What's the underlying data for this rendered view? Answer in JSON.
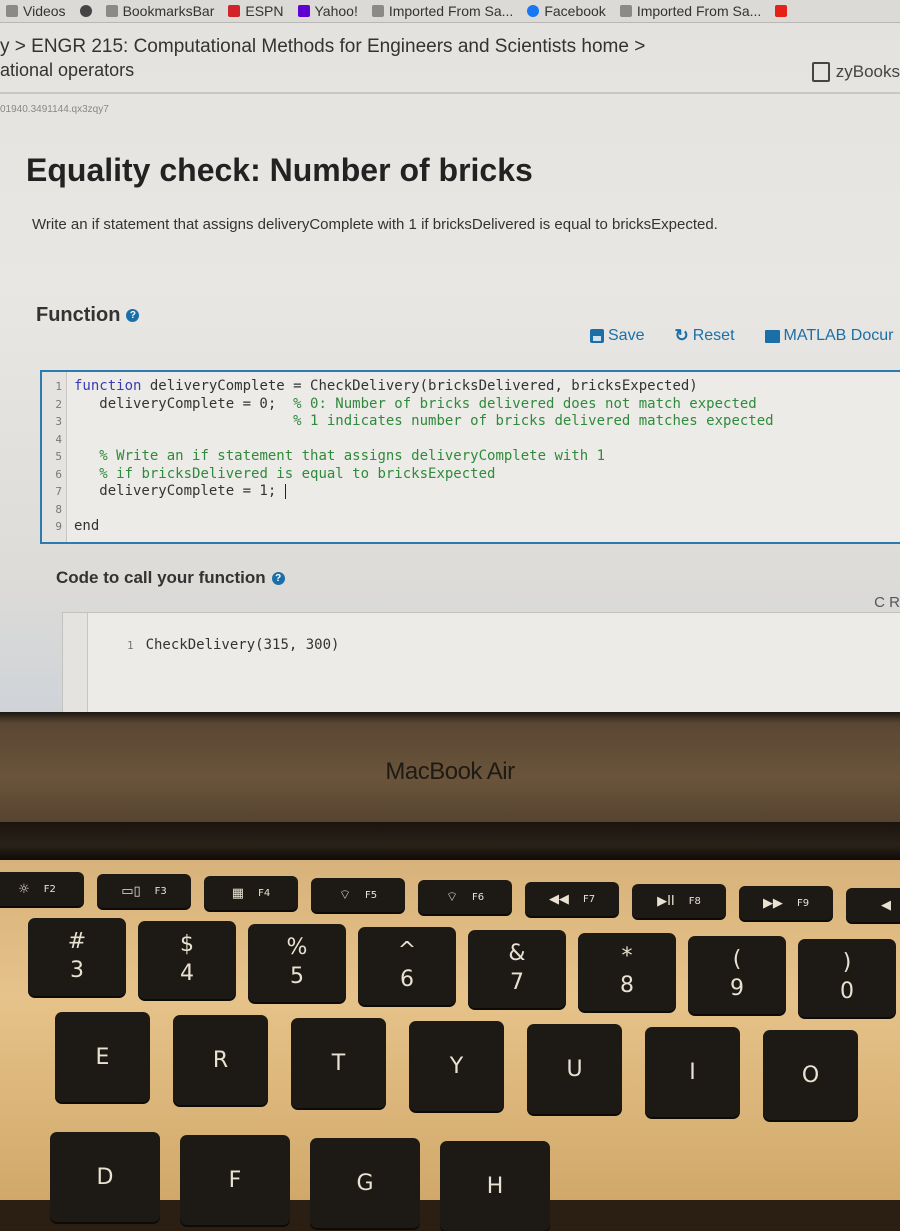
{
  "bookmarks_bar": {
    "items": [
      {
        "label": "Videos",
        "icon": "folder-icon"
      },
      {
        "label": "",
        "icon": "globe-icon"
      },
      {
        "label": "BookmarksBar",
        "icon": "folder-icon"
      },
      {
        "label": "ESPN",
        "icon": "espn-icon"
      },
      {
        "label": "Yahoo!",
        "icon": "yahoo-icon"
      },
      {
        "label": "Imported From Sa...",
        "icon": "folder-icon"
      },
      {
        "label": "Facebook",
        "icon": "facebook-icon"
      },
      {
        "label": "Imported From Sa...",
        "icon": "folder-icon"
      },
      {
        "label": "",
        "icon": "youtube-icon"
      }
    ]
  },
  "breadcrumb": {
    "line1": "y > ENGR 215: Computational Methods for Engineers and Scientists home >",
    "line2": "ational operators",
    "brand": "zyBooks"
  },
  "session_id": "01940.3491144.qx3zqy7",
  "challenge": {
    "title": "Equality check: Number of bricks",
    "instructions": "Write an if statement that assigns deliveryComplete with 1 if bricksDelivered is equal to bricksExpected."
  },
  "function_section": {
    "label": "Function",
    "toolbar": {
      "save": "Save",
      "reset": "Reset",
      "docs": "MATLAB Docur"
    },
    "lines": [
      {
        "n": "1",
        "kw": "function",
        "code": " deliveryComplete = CheckDelivery(bricksDelivered, bricksExpected)",
        "comment": ""
      },
      {
        "n": "2",
        "kw": "",
        "code": "   deliveryComplete = 0;  ",
        "comment": "% 0: Number of bricks delivered does not match expected"
      },
      {
        "n": "3",
        "kw": "",
        "code": "                          ",
        "comment": "% 1 indicates number of bricks delivered matches expected"
      },
      {
        "n": "4",
        "kw": "",
        "code": "",
        "comment": ""
      },
      {
        "n": "5",
        "kw": "",
        "code": "   ",
        "comment": "% Write an if statement that assigns deliveryComplete with 1"
      },
      {
        "n": "6",
        "kw": "",
        "code": "   ",
        "comment": "% if bricksDelivered is equal to bricksExpected"
      },
      {
        "n": "7",
        "kw": "",
        "code": "   deliveryComplete = 1; ",
        "comment": ""
      },
      {
        "n": "8",
        "kw": "",
        "code": "",
        "comment": ""
      },
      {
        "n": "9",
        "kw": "",
        "code": "end",
        "comment": ""
      }
    ]
  },
  "call_section": {
    "label": "Code to call your function",
    "reset_partial": "C R",
    "lines": [
      {
        "n": "1",
        "code": "CheckDelivery(315, 300)"
      }
    ]
  },
  "laptop": {
    "brand": "MacBook Air",
    "function_keys": [
      {
        "label": "F2",
        "icon": "☼"
      },
      {
        "label": "F3",
        "icon": "▭▯"
      },
      {
        "label": "F4",
        "icon": "▦"
      },
      {
        "label": "F5",
        "icon": "⌔"
      },
      {
        "label": "F6",
        "icon": "⌔"
      },
      {
        "label": "F7",
        "icon": "◀◀"
      },
      {
        "label": "F8",
        "icon": "▶II"
      },
      {
        "label": "F9",
        "icon": "▶▶"
      },
      {
        "label": "",
        "icon": "◀"
      }
    ],
    "number_keys": [
      {
        "top": "#",
        "bottom": "3"
      },
      {
        "top": "$",
        "bottom": "4"
      },
      {
        "top": "%",
        "bottom": "5"
      },
      {
        "top": "^",
        "bottom": "6"
      },
      {
        "top": "&",
        "bottom": "7"
      },
      {
        "top": "*",
        "bottom": "8"
      },
      {
        "top": "(",
        "bottom": "9"
      },
      {
        "top": ")",
        "bottom": "0"
      }
    ],
    "letter_keys_row1": [
      "E",
      "R",
      "T",
      "Y",
      "U",
      "I",
      "O"
    ],
    "letter_keys_row2": [
      "D",
      "F",
      "G",
      "H"
    ]
  },
  "colors": {
    "accent": "#1b6fa8",
    "keyword": "#3c3cb0",
    "comment": "#2f8a3c",
    "editor_border": "#2b7bb0"
  }
}
